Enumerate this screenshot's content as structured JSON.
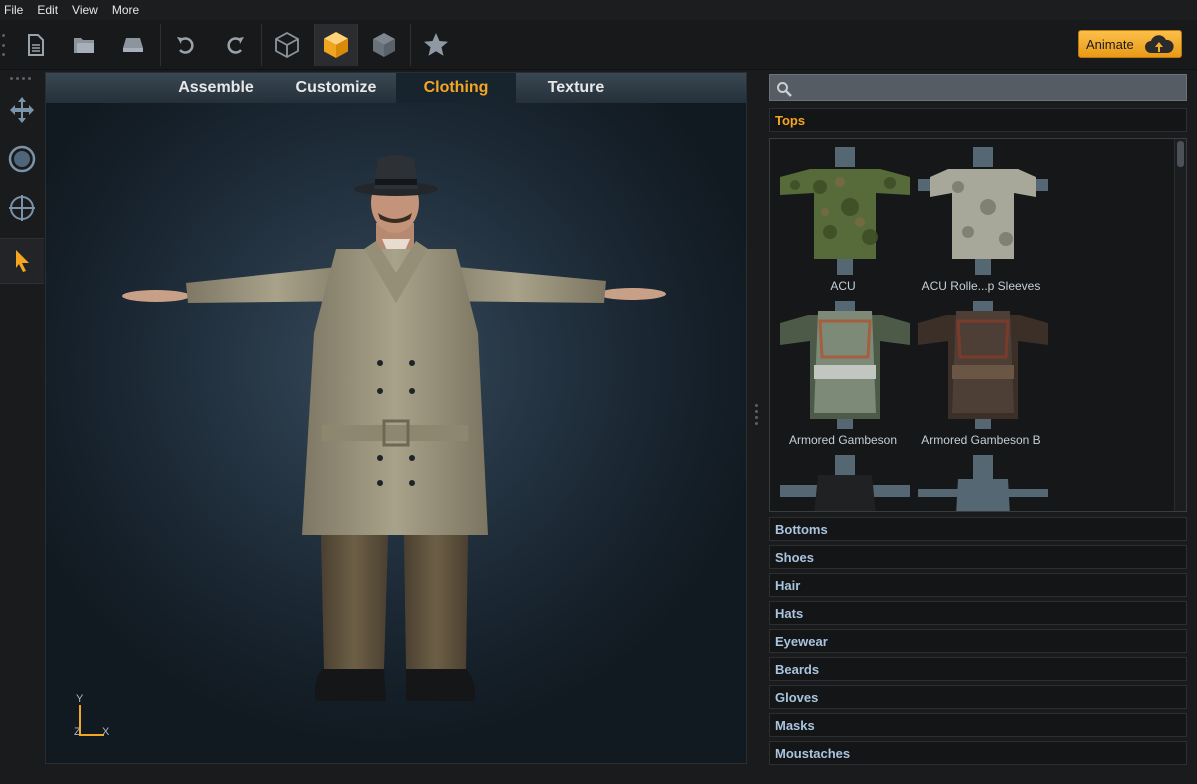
{
  "menu": [
    "File",
    "Edit",
    "View",
    "More"
  ],
  "toolbar": {
    "buttons": [
      "new-document",
      "open-folder",
      "save",
      "undo",
      "redo",
      "wireframe-cube",
      "solid-cube",
      "textured-cube",
      "favorite-star"
    ],
    "animate_label": "Animate"
  },
  "left_tools": [
    "move",
    "rotate",
    "target",
    "select"
  ],
  "viewport": {
    "tabs": [
      "Assemble",
      "Customize",
      "Clothing",
      "Texture"
    ],
    "active_tab": "Clothing",
    "axis": {
      "y": "Y",
      "x": "X",
      "z": "Z"
    }
  },
  "panel": {
    "search": {
      "placeholder": "",
      "value": ""
    },
    "open_category": "Tops",
    "items": [
      {
        "label": "ACU"
      },
      {
        "label": "ACU Rolle...p Sleeves"
      },
      {
        "label": "Armored Gambeson"
      },
      {
        "label": "Armored Gambeson B"
      },
      {
        "label": ""
      },
      {
        "label": ""
      }
    ],
    "categories": [
      "Bottoms",
      "Shoes",
      "Hair",
      "Hats",
      "Eyewear",
      "Beards",
      "Gloves",
      "Masks",
      "Moustaches"
    ]
  },
  "colors": {
    "accent": "#f4a623",
    "category_text": "#a9c4de",
    "viewport_bg": "#233240"
  }
}
